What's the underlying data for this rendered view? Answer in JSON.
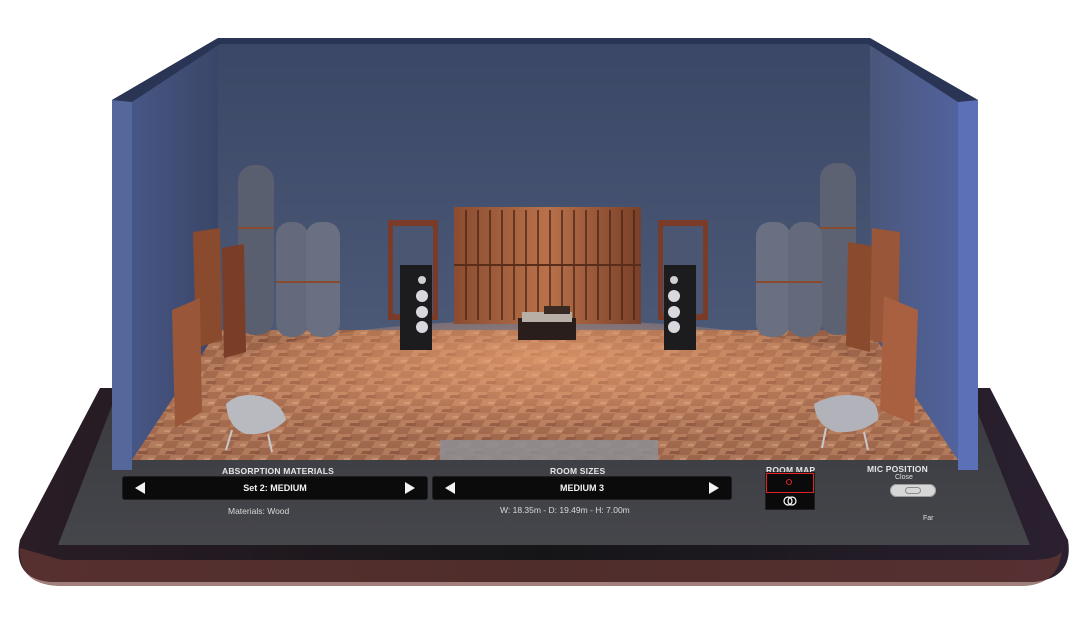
{
  "absorption": {
    "heading": "ABSORPTION MATERIALS",
    "selected": "Set 2: MEDIUM",
    "materials_text": "Materials: Wood"
  },
  "room_sizes": {
    "heading": "ROOM SIZES",
    "selected": "MEDIUM 3",
    "dimensions_text": "W: 18.35m - D: 19.49m - H: 7.00m"
  },
  "room_map": {
    "heading": "ROOM MAP"
  },
  "mic_position": {
    "heading": "MIC POSITION",
    "close_label": "Close",
    "far_label": "Far",
    "level": 0.5
  },
  "icons": {
    "prev": "triangle-left-icon",
    "next": "triangle-right-icon",
    "listener": "rings-icon"
  },
  "colors": {
    "wall": "#3d4a6e",
    "accent_red": "#e2202a",
    "panel_wood": "#8a4a2e",
    "screen": "#3b3c40"
  }
}
